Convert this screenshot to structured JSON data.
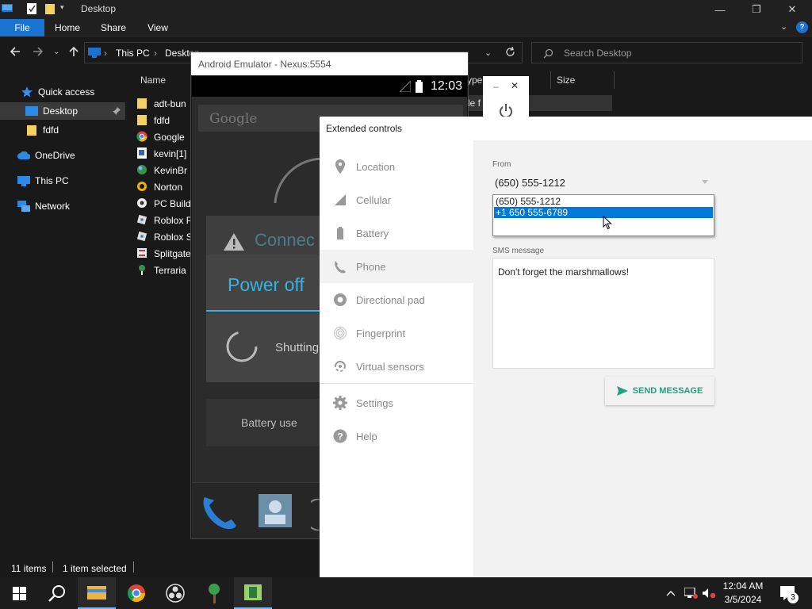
{
  "explorer": {
    "title": "Desktop",
    "ribbon_tabs": {
      "file": "File",
      "home": "Home",
      "share": "Share",
      "view": "View"
    },
    "window_controls": {
      "minimize": "—",
      "maximize": "❐",
      "close": "✕"
    },
    "address": {
      "this_pc": "This PC",
      "desktop": "Desktop",
      "sep": "›"
    },
    "search_placeholder": "Search Desktop",
    "nav": {
      "quick_access": "Quick access",
      "desktop": "Desktop",
      "fdfd": "fdfd",
      "onedrive": "OneDrive",
      "this_pc": "This PC",
      "network": "Network"
    },
    "columns": {
      "name": "Name",
      "type": "ype",
      "size": "Size"
    },
    "files": [
      "adt-bun",
      "fdfd",
      "Google",
      "kevin[1]",
      "KevinBr",
      "Norton",
      "PC Build",
      "Roblox P",
      "Roblox S",
      "Splitgate",
      "Terraria"
    ],
    "partial_type_text": "le f",
    "status": {
      "items": "11 items",
      "selected": "1 item selected"
    }
  },
  "emulator": {
    "title": "Android Emulator - Nexus:5554",
    "clock": "12:03",
    "search_hint": "Google",
    "connect_text": "Connec",
    "power_off": "Power off",
    "shutting": "Shutting",
    "battery_use": "Battery use"
  },
  "extended": {
    "title": "Extended controls",
    "sidebar": {
      "location": "Location",
      "cellular": "Cellular",
      "battery": "Battery",
      "phone": "Phone",
      "dpad": "Directional pad",
      "fingerprint": "Fingerprint",
      "sensors": "Virtual sensors",
      "settings": "Settings",
      "help": "Help"
    },
    "from_label": "From",
    "from_value": "(650) 555-1212",
    "from_options": [
      "(650) 555-1212",
      "+1 650 555-6789"
    ],
    "sms_label": "SMS message",
    "sms_value": "Don't forget the marshmallows!",
    "send_label": "SEND MESSAGE",
    "accent_color": "#1fa37e"
  },
  "taskbar": {
    "time": "12:04 AM",
    "date": "3/5/2024",
    "notification_count": "3"
  }
}
